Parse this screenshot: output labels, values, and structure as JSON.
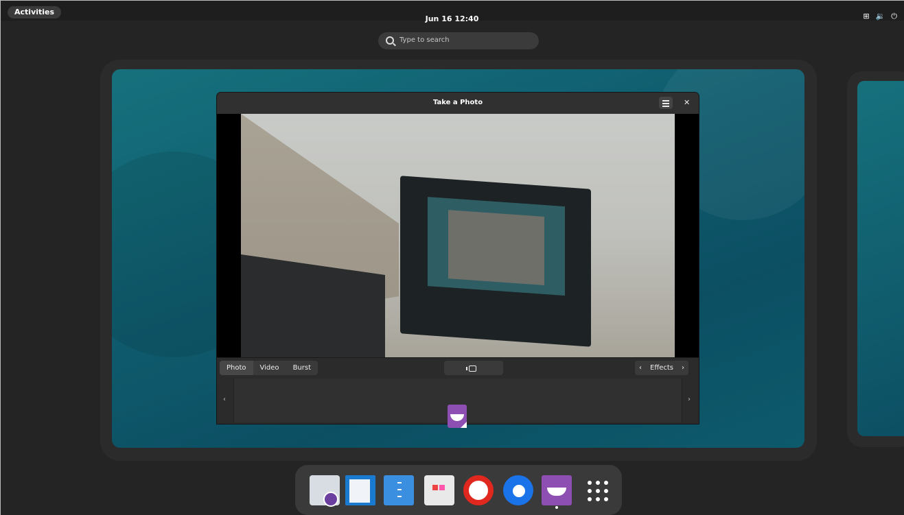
{
  "topbar": {
    "activities_label": "Activities",
    "clock": "Jun 16  12:40",
    "tray_icons": [
      "network-icon",
      "volume-icon",
      "power-icon"
    ]
  },
  "search": {
    "placeholder": "Type to search"
  },
  "window": {
    "title": "Take a Photo",
    "modes": [
      "Photo",
      "Video",
      "Burst"
    ],
    "active_mode": "Photo",
    "effects_label": "Effects",
    "nav_prev": "‹",
    "nav_next": "›"
  },
  "dock": {
    "apps": [
      "evolution-icon",
      "libreoffice-writer-icon",
      "files-icon",
      "software-center-icon",
      "help-icon",
      "chromium-icon",
      "cheese-icon",
      "app-grid-icon"
    ],
    "running": [
      "cheese-icon"
    ]
  },
  "colors": {
    "topbar_bg": "#1e1e1e",
    "wallpaper_accent": "#0f5c6e",
    "cheese_purple": "#8e4fb2"
  }
}
